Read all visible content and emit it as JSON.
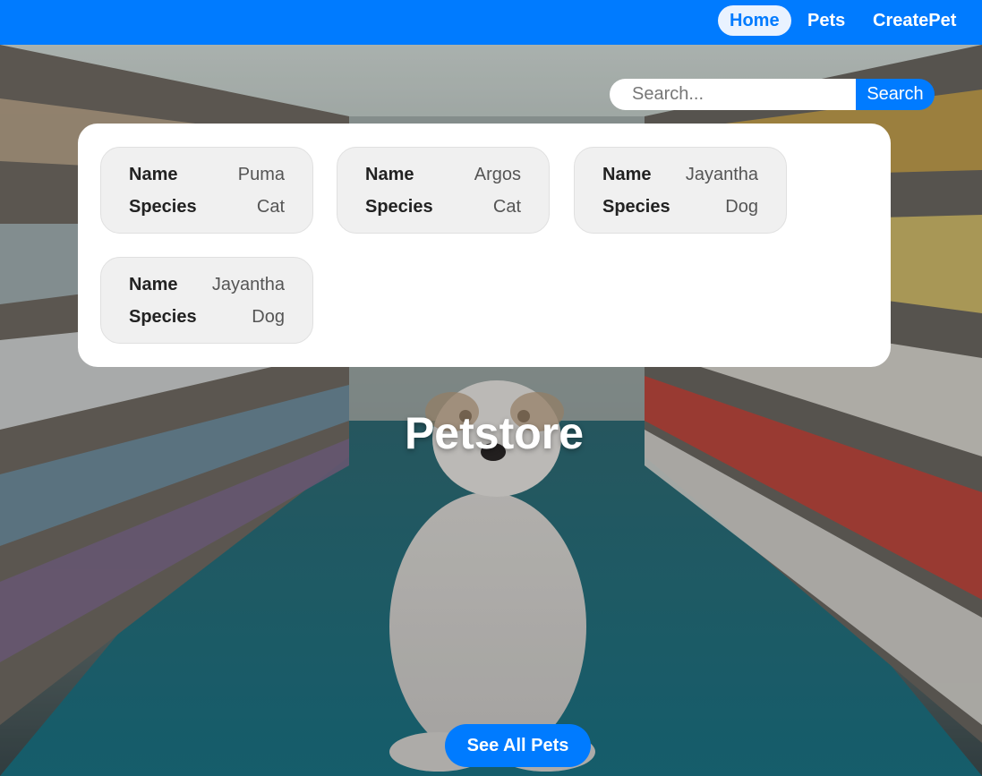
{
  "nav": {
    "links": [
      {
        "label": "Home",
        "active": true
      },
      {
        "label": "Pets",
        "active": false
      },
      {
        "label": "CreatePet",
        "active": false
      }
    ]
  },
  "search": {
    "placeholder": "Search...",
    "value": "",
    "button_label": "Search"
  },
  "pets": {
    "field_labels": {
      "name": "Name",
      "species": "Species"
    },
    "items": [
      {
        "name": "Puma",
        "species": "Cat"
      },
      {
        "name": "Argos",
        "species": "Cat"
      },
      {
        "name": "Jayantha",
        "species": "Dog"
      },
      {
        "name": "Jayantha",
        "species": "Dog"
      }
    ]
  },
  "hero": {
    "title": "Petstore",
    "cta_label": "See All Pets",
    "background": "pet-store-aisle-with-white-puppy"
  },
  "colors": {
    "accent": "#007bff",
    "panel": "#ffffff",
    "card": "#f0f0f0"
  }
}
